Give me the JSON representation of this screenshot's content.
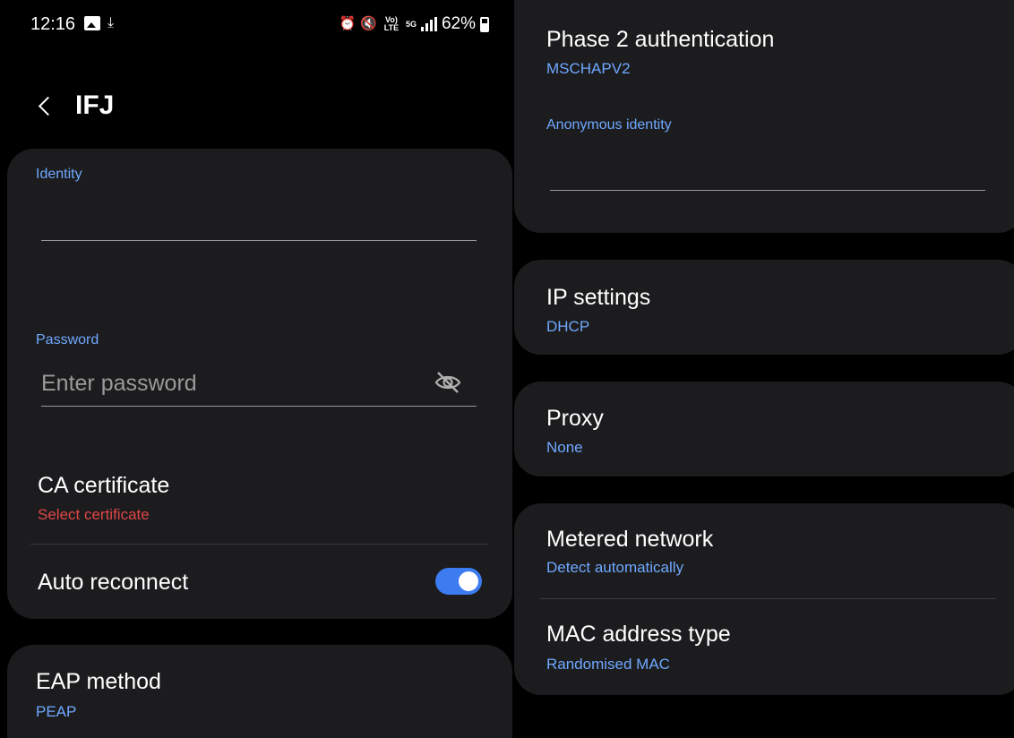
{
  "status_bar": {
    "time": "12:16",
    "network_type": "5G",
    "volte": "Vo) LTE",
    "battery": "62%",
    "icons": [
      "gallery-icon",
      "download-icon",
      "alarm-icon",
      "mute-icon",
      "volte-icon",
      "5g-icon",
      "signal-icon",
      "battery-icon"
    ]
  },
  "header": {
    "title": "IFJ"
  },
  "identity": {
    "label": "Identity",
    "value": ""
  },
  "password": {
    "label": "Password",
    "placeholder": "Enter password"
  },
  "ca_certificate": {
    "title": "CA certificate",
    "value": "Select certificate"
  },
  "auto_reconnect": {
    "label": "Auto reconnect",
    "enabled": true
  },
  "eap_method": {
    "title": "EAP method",
    "value": "PEAP"
  },
  "phase2": {
    "title": "Phase 2 authentication",
    "value": "MSCHAPV2"
  },
  "anonymous_identity": {
    "label": "Anonymous identity",
    "value": ""
  },
  "ip_settings": {
    "title": "IP settings",
    "value": "DHCP"
  },
  "proxy": {
    "title": "Proxy",
    "value": "None"
  },
  "metered_network": {
    "title": "Metered network",
    "value": "Detect automatically"
  },
  "mac_address": {
    "title": "MAC address type",
    "value": "Randomised MAC"
  },
  "colors": {
    "background": "#000000",
    "card": "#1c1c1e",
    "accent": "#6fa8ff",
    "toggle_on": "#3d7bf0",
    "warning": "#e04646"
  }
}
